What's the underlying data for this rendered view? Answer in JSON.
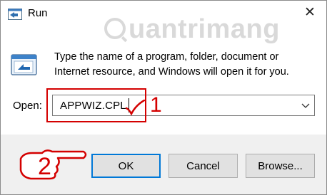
{
  "window": {
    "title": "Run",
    "app_icon": "run-app-icon",
    "close_icon": "close-icon",
    "close_glyph": "✕"
  },
  "watermark": {
    "text": "uantrimang"
  },
  "main": {
    "icon": "run-program-icon",
    "description": "Type the name of a program, folder, document or Internet resource, and Windows will open it for you."
  },
  "open_field": {
    "label": "Open:",
    "value": "APPWIZ.CPL",
    "dropdown_icon": "chevron-down-icon"
  },
  "annotations": {
    "step1": "1",
    "step2": "2",
    "check_icon": "check-mark-icon",
    "hand_icon": "pointing-hand-icon",
    "color": "#d40000"
  },
  "buttons": {
    "ok": "OK",
    "cancel": "Cancel",
    "browse": "Browse..."
  },
  "colors": {
    "focus_border": "#0078d7",
    "footer_bg": "#f0f0f0",
    "button_bg": "#e1e1e1"
  }
}
